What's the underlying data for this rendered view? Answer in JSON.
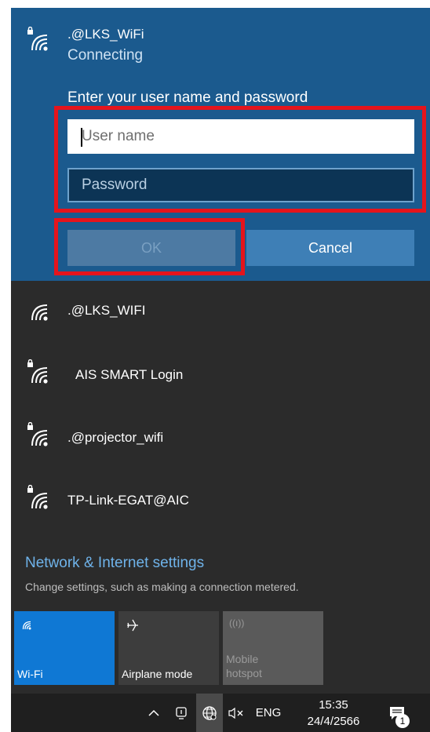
{
  "connecting_network": {
    "name": ".@LKS_WiFi",
    "status": "Connecting",
    "prompt": "Enter your user name and password",
    "username_placeholder": "User name",
    "password_placeholder": "Password",
    "ok_label": "OK",
    "cancel_label": "Cancel"
  },
  "networks": [
    {
      "name": ".@LKS_WIFI",
      "secured": false
    },
    {
      "name": "AIS SMART Login",
      "secured": true
    },
    {
      "name": ".@projector_wifi",
      "secured": true
    },
    {
      "name": "TP-Link-EGAT@AIC",
      "secured": true
    }
  ],
  "settings": {
    "link": "Network & Internet settings",
    "description": "Change settings, such as making a connection metered."
  },
  "quick_actions": [
    {
      "label": "Wi-Fi",
      "icon": "wifi-icon",
      "state": "on"
    },
    {
      "label": "Airplane mode",
      "icon": "airplane-icon",
      "state": "off"
    },
    {
      "label": "Mobile hotspot",
      "label_line1": "Mobile",
      "label_line2": "hotspot",
      "icon": "hotspot-icon",
      "state": "disabled"
    }
  ],
  "taskbar": {
    "language": "ENG",
    "time": "15:35",
    "date": "24/4/2566",
    "notification_count": "1"
  },
  "colors": {
    "accent": "#0f78d4",
    "active_panel": "#1b5a8e",
    "flyout_bg": "#2b2b2b",
    "highlight": "#e5141c"
  }
}
